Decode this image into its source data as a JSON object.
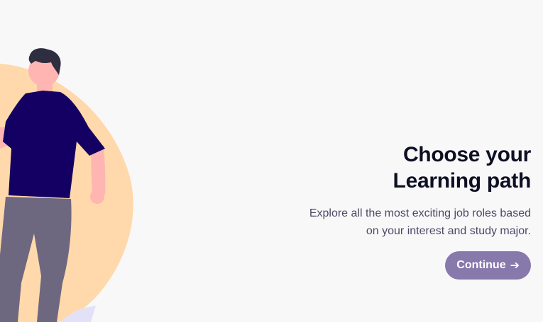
{
  "onboarding": {
    "title_line1": "Choose your",
    "title_line2": "Learning path",
    "description_line1": "Explore all the most exciting job roles based",
    "description_line2": "on your interest and study major.",
    "continue_label": "Continue",
    "continue_icon": "➔"
  },
  "colors": {
    "background": "#f8f8f9",
    "blob": "#ffd9ab",
    "shirt": "#140063",
    "pants": "#6d6880",
    "skin": "#ffb6b3",
    "hair": "#2f2e41",
    "button": "#8879ac"
  },
  "illustration": {
    "name": "person-standing-illustration"
  }
}
